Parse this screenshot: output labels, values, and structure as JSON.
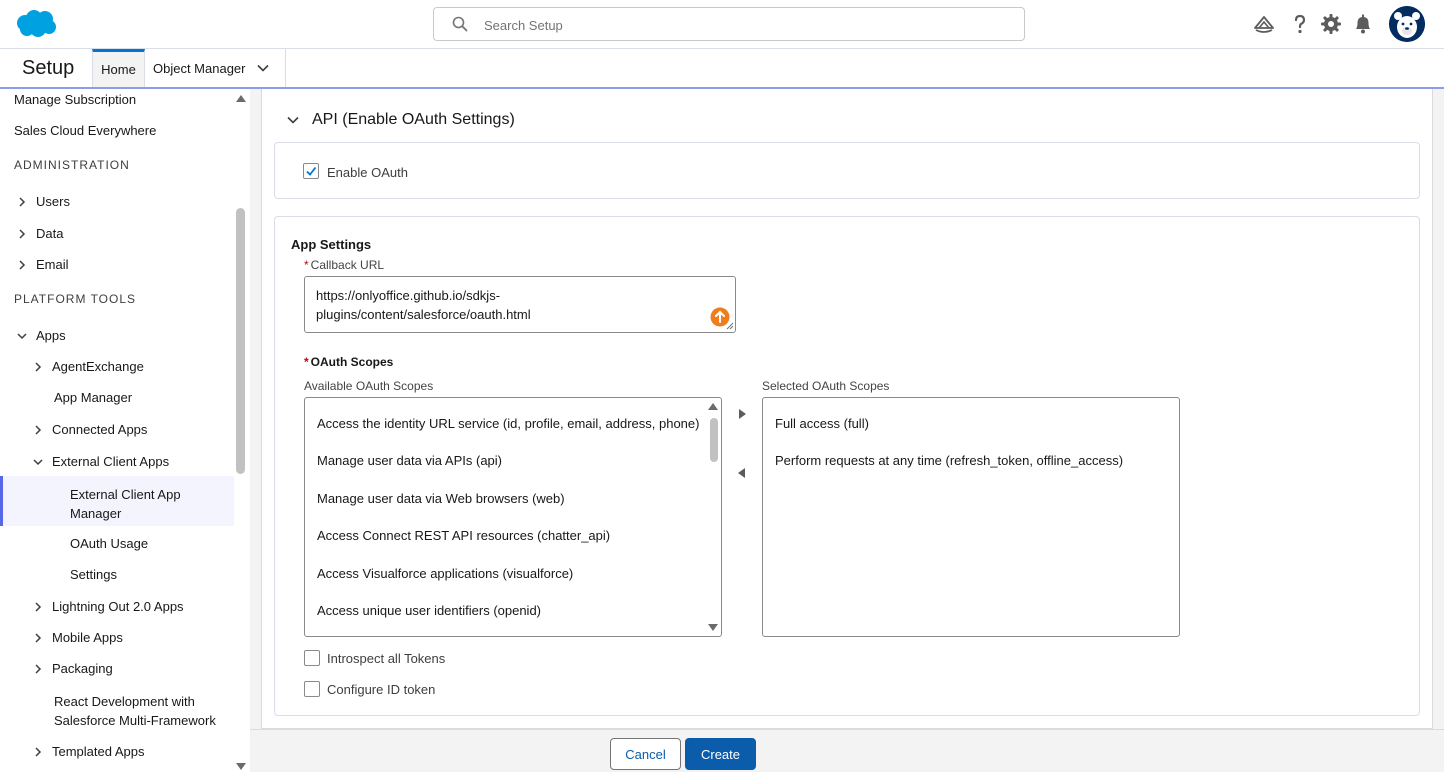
{
  "header": {
    "search_placeholder": "Search Setup"
  },
  "context_nav": {
    "app_name": "Setup",
    "tabs": [
      {
        "label": "Home"
      },
      {
        "label": "Object Manager"
      }
    ]
  },
  "sidebar": {
    "items_top": [
      {
        "label": "Manage Subscription"
      },
      {
        "label": "Sales Cloud Everywhere"
      }
    ],
    "heading_admin": "ADMINISTRATION",
    "admin_items": [
      {
        "label": "Users"
      },
      {
        "label": "Data"
      },
      {
        "label": "Email"
      }
    ],
    "heading_platform": "PLATFORM TOOLS",
    "apps": {
      "label": "Apps"
    },
    "apps_items": [
      {
        "label": "AgentExchange"
      },
      {
        "label": "App Manager"
      },
      {
        "label": "Connected Apps"
      },
      {
        "label": "External Client Apps"
      }
    ],
    "eca_items": [
      {
        "label_line1": "External Client App",
        "label_line2": "Manager"
      },
      {
        "label": "OAuth Usage"
      },
      {
        "label": "Settings"
      }
    ],
    "more_items": [
      {
        "label": "Lightning Out 2.0 Apps"
      },
      {
        "label": "Mobile Apps"
      },
      {
        "label": "Packaging"
      },
      {
        "label_line1": "React Development with",
        "label_line2": "Salesforce Multi-Framework"
      },
      {
        "label": "Templated Apps"
      }
    ]
  },
  "main": {
    "section_title": "API (Enable OAuth Settings)",
    "enable_oauth": {
      "label": "Enable OAuth",
      "checked": true
    },
    "app_settings": {
      "heading": "App Settings",
      "callback_url_label": "Callback URL",
      "required_marker": "*",
      "callback_url_line1": "https://onlyoffice.github.io/sdkjs-",
      "callback_url_line2": "plugins/content/salesforce/oauth.html",
      "oauth_scopes_label": "OAuth Scopes",
      "available_label": "Available OAuth Scopes",
      "selected_label": "Selected OAuth Scopes",
      "available_scopes": [
        "Access the identity URL service (id, profile, email, address, phone)",
        "Manage user data via APIs (api)",
        "Manage user data via Web browsers (web)",
        "Access Connect REST API resources (chatter_api)",
        "Access Visualforce applications (visualforce)",
        "Access unique user identifiers (openid)"
      ],
      "selected_scopes": [
        "Full access (full)",
        "Perform requests at any time (refresh_token, offline_access)"
      ],
      "introspect_tokens": {
        "label": "Introspect all Tokens",
        "checked": false
      },
      "configure_id_token": {
        "label": "Configure ID token",
        "checked": false
      }
    }
  },
  "footer": {
    "cancel_label": "Cancel",
    "create_label": "Create"
  },
  "colors": {
    "brand_blue": "#0b5cab",
    "cloud_blue": "#00a1e0",
    "active_nav_border": "#5867e8",
    "required_red": "#ba0517",
    "upload_orange": "#ef7d1b"
  }
}
